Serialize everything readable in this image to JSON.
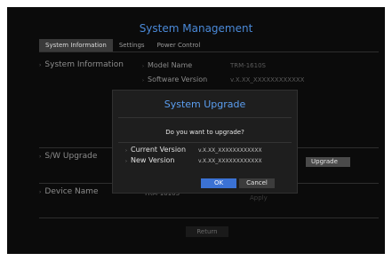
{
  "page_title": "System Management",
  "tabs": [
    {
      "label": "System Information",
      "active": true
    },
    {
      "label": "Settings",
      "active": false
    },
    {
      "label": "Power Control",
      "active": false
    }
  ],
  "sections": {
    "system_info": {
      "label": "System Information",
      "model_name_label": "Model Name",
      "model_name_value": "TRM-1610S",
      "software_version_label": "Software Version",
      "software_version_value": "v.X.XX_XXXXXXXXXXXX"
    },
    "sw_upgrade": {
      "label": "S/W Upgrade",
      "upgrade_button": "Upgrade"
    },
    "device_name": {
      "label": "Device Name",
      "value": "TRM-1610S",
      "apply_button": "Apply"
    }
  },
  "return_button": "Return",
  "dialog": {
    "title": "System Upgrade",
    "question": "Do you want to upgrade?",
    "current_version_label": "Current Version",
    "current_version_value": "v.X.XX_XXXXXXXXXXXX",
    "new_version_label": "New Version",
    "new_version_value": "v.X.XX_XXXXXXXXXXXX",
    "ok_button": "OK",
    "cancel_button": "Cancel"
  },
  "colors": {
    "accent": "#4a89d8",
    "ok": "#3b72d4",
    "background": "#0b0b0b"
  }
}
